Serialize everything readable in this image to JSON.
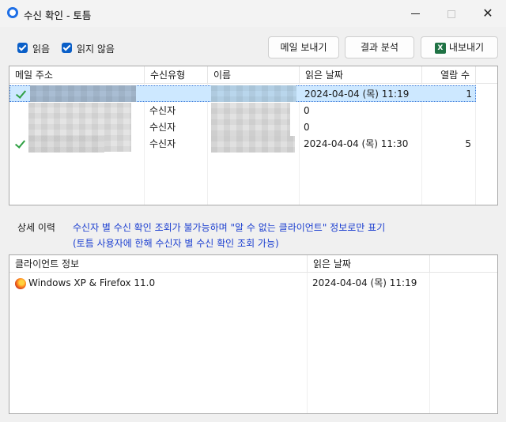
{
  "window": {
    "title": "수신 확인 - 토틈",
    "icon": "app-icon",
    "controls": [
      "minimize",
      "maximize",
      "close"
    ]
  },
  "filters": {
    "read_label": "읽음",
    "read_checked": true,
    "unread_label": "읽지 않음",
    "unread_checked": true
  },
  "toolbar": {
    "send_label": "메일 보내기",
    "analyze_label": "결과 분석",
    "export_label": "내보내기",
    "export_icon": "excel-icon"
  },
  "recipients": {
    "columns": [
      "메일 주소",
      "수신유형",
      "이름",
      "읽은 날짜",
      "열람 수"
    ],
    "rows": [
      {
        "read": true,
        "selected": true,
        "email": "",
        "type": "",
        "name": "",
        "date": "2024-04-04 (목) 11:19",
        "count": "1"
      },
      {
        "read": false,
        "selected": false,
        "email": "",
        "type": "수신자",
        "name": "",
        "date": "0",
        "count": ""
      },
      {
        "read": false,
        "selected": false,
        "email": "",
        "type": "수신자",
        "name": "",
        "date": "0",
        "count": ""
      },
      {
        "read": true,
        "selected": false,
        "email": "",
        "type": "수신자",
        "name": "",
        "date": "2024-04-04 (목) 11:30",
        "count": "5"
      }
    ]
  },
  "detail": {
    "label": "상세 이력",
    "note_line1": "수신자 별 수신 확인 조회가 불가능하며 \"알 수 없는 클라이언트\" 정보로만 표기",
    "note_line2": "(토틈 사용자에 한해 수신자 별 수신 확인 조회 가능)",
    "columns": [
      "클라이언트 정보",
      "읽은 날짜"
    ],
    "rows": [
      {
        "client": "Windows XP & Firefox 11.0",
        "icon": "firefox-icon",
        "date": "2024-04-04 (목) 11:19"
      }
    ]
  },
  "colors": {
    "accent": "#0a5fc8",
    "selection": "#cde8ff",
    "note_text": "#1c3fd0",
    "check": "#2fa043"
  }
}
